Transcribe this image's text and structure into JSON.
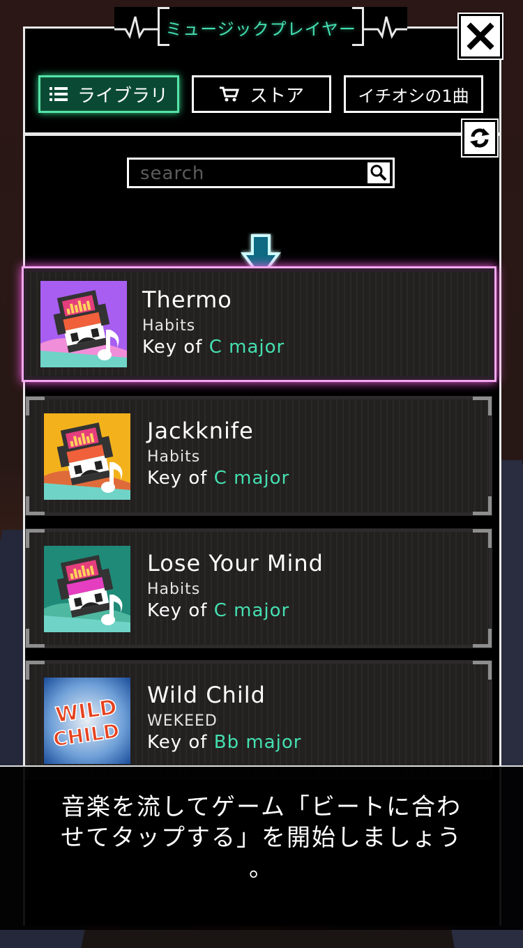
{
  "header": {
    "title": "ミュージックプレイヤー"
  },
  "icons": {
    "close": "close-icon",
    "list": "list-icon",
    "cart": "cart-icon",
    "refresh": "refresh-icon",
    "search": "search-icon",
    "arrow": "arrow-down-icon",
    "music_note": "music-note-icon"
  },
  "colors": {
    "accent_green": "#44e0b0",
    "active_tab": "#56e3a8",
    "selected_glow": "#ff5fe8"
  },
  "tabs": [
    {
      "label": "ライブラリ",
      "active": true
    },
    {
      "label": "ストア",
      "active": false
    },
    {
      "label": "イチオシの1曲",
      "active": false
    }
  ],
  "search": {
    "placeholder": "search",
    "value": ""
  },
  "tracks": [
    {
      "title": "Thermo",
      "artist": "Habits",
      "key_prefix": "Key of",
      "key": "C major",
      "selected": true,
      "art_color": "#a75ef1"
    },
    {
      "title": "Jackknife",
      "artist": "Habits",
      "key_prefix": "Key of",
      "key": "C major",
      "selected": false,
      "art_color": "#f3b21c"
    },
    {
      "title": "Lose Your Mind",
      "artist": "Habits",
      "key_prefix": "Key of",
      "key": "C major",
      "selected": false,
      "art_color": "#1f8a78"
    },
    {
      "title": "Wild Child",
      "artist": "WEKEED",
      "key_prefix": "Key of",
      "key": "Bb major",
      "selected": false,
      "art_text": "WILD CHILD"
    }
  ],
  "toast": {
    "line1": "音楽を流してゲーム「ビートに合わ",
    "line2": "せてタップする」を開始しましょう",
    "line3": "。"
  }
}
